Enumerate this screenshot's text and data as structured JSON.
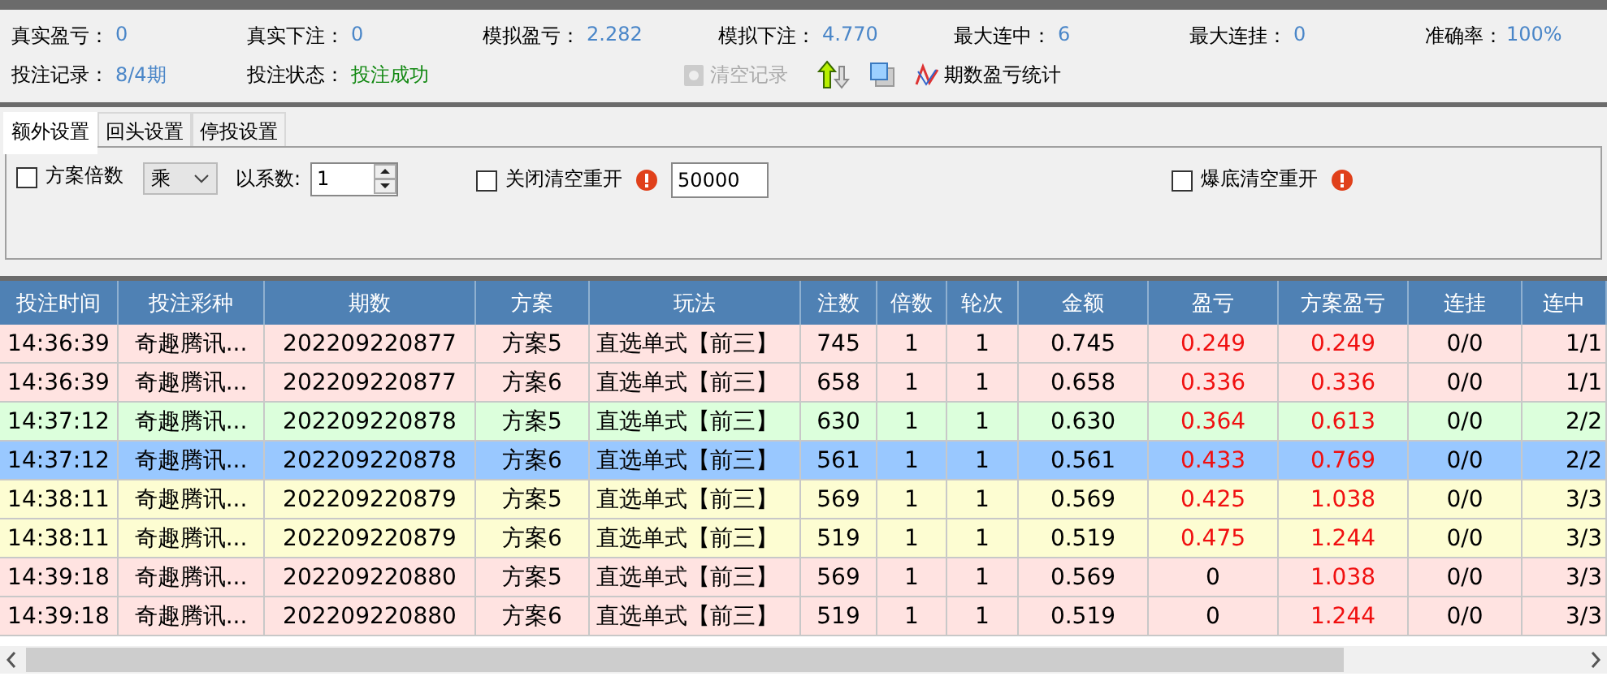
{
  "stats": [
    {
      "label": "真实盈亏：",
      "value": "0"
    },
    {
      "label": "真实下注：",
      "value": "0"
    },
    {
      "label": "模拟盈亏：",
      "value": "2.282"
    },
    {
      "label": "模拟下注：",
      "value": "4.770"
    },
    {
      "label": "最大连中：",
      "value": "6"
    },
    {
      "label": "最大连挂：",
      "value": "0"
    },
    {
      "label": "准确率：",
      "value": "100%"
    }
  ],
  "record": {
    "label": "投注记录：",
    "value": "8/4期"
  },
  "status": {
    "label": "投注状态：",
    "value": "投注成功"
  },
  "toolbar": {
    "clear": {
      "label": "清空记录",
      "disabled": true
    },
    "stats_label": "期数盈亏统计"
  },
  "tabs": [
    {
      "label": "额外设置",
      "selected": true
    },
    {
      "label": "回头设置",
      "selected": false
    },
    {
      "label": "停投设置",
      "selected": false
    }
  ],
  "settings": {
    "multiplier": {
      "label": "方案倍数",
      "checked": false
    },
    "operator": "乘",
    "factor_label": "以系数:",
    "factor": "1",
    "close_reset": {
      "label": "关闭清空重开",
      "checked": false
    },
    "close_value": "50000",
    "bust_reset": {
      "label": "爆底清空重开",
      "checked": false
    }
  },
  "table": {
    "columns": [
      "投注时间",
      "投注彩种",
      "期数",
      "方案",
      "玩法",
      "注数",
      "倍数",
      "轮次",
      "金额",
      "盈亏",
      "方案盈亏",
      "连挂",
      "连中"
    ],
    "rows": [
      {
        "cells": [
          "14:36:39",
          "奇趣腾讯...",
          "202209220877",
          "方案5",
          "直选单式【前三】",
          "745",
          "1",
          "1",
          "0.745",
          "0.249",
          "0.249",
          "0/0",
          "1/1"
        ],
        "color": "#ffe3e1",
        "selected": false,
        "profit_red": true,
        "plan_red": true
      },
      {
        "cells": [
          "14:36:39",
          "奇趣腾讯...",
          "202209220877",
          "方案6",
          "直选单式【前三】",
          "658",
          "1",
          "1",
          "0.658",
          "0.336",
          "0.336",
          "0/0",
          "1/1"
        ],
        "color": "#ffe3e1",
        "selected": false,
        "profit_red": true,
        "plan_red": true
      },
      {
        "cells": [
          "14:37:12",
          "奇趣腾讯...",
          "202209220878",
          "方案5",
          "直选单式【前三】",
          "630",
          "1",
          "1",
          "0.630",
          "0.364",
          "0.613",
          "0/0",
          "2/2"
        ],
        "color": "#dcffdc",
        "selected": false,
        "profit_red": true,
        "plan_red": true
      },
      {
        "cells": [
          "14:37:12",
          "奇趣腾讯...",
          "202209220878",
          "方案6",
          "直选单式【前三】",
          "561",
          "1",
          "1",
          "0.561",
          "0.433",
          "0.769",
          "0/0",
          "2/2"
        ],
        "selected": true,
        "profit_red": true,
        "plan_red": true
      },
      {
        "cells": [
          "14:38:11",
          "奇趣腾讯...",
          "202209220879",
          "方案5",
          "直选单式【前三】",
          "569",
          "1",
          "1",
          "0.569",
          "0.425",
          "1.038",
          "0/0",
          "3/3"
        ],
        "color": "#fdfdd2",
        "selected": false,
        "profit_red": true,
        "plan_red": true
      },
      {
        "cells": [
          "14:38:11",
          "奇趣腾讯...",
          "202209220879",
          "方案6",
          "直选单式【前三】",
          "519",
          "1",
          "1",
          "0.519",
          "0.475",
          "1.244",
          "0/0",
          "3/3"
        ],
        "color": "#fdfdd2",
        "selected": false,
        "profit_red": true,
        "plan_red": true
      },
      {
        "cells": [
          "14:39:18",
          "奇趣腾讯...",
          "202209220880",
          "方案5",
          "直选单式【前三】",
          "569",
          "1",
          "1",
          "0.569",
          "0",
          "1.038",
          "0/0",
          "3/3"
        ],
        "color": "#ffe3e1",
        "selected": false,
        "profit_red": false,
        "plan_red": true
      },
      {
        "cells": [
          "14:39:18",
          "奇趣腾讯...",
          "202209220880",
          "方案6",
          "直选单式【前三】",
          "519",
          "1",
          "1",
          "0.519",
          "0",
          "1.244",
          "0/0",
          "3/3"
        ],
        "color": "#ffe3e1",
        "selected": false,
        "profit_red": false,
        "plan_red": true
      }
    ]
  }
}
